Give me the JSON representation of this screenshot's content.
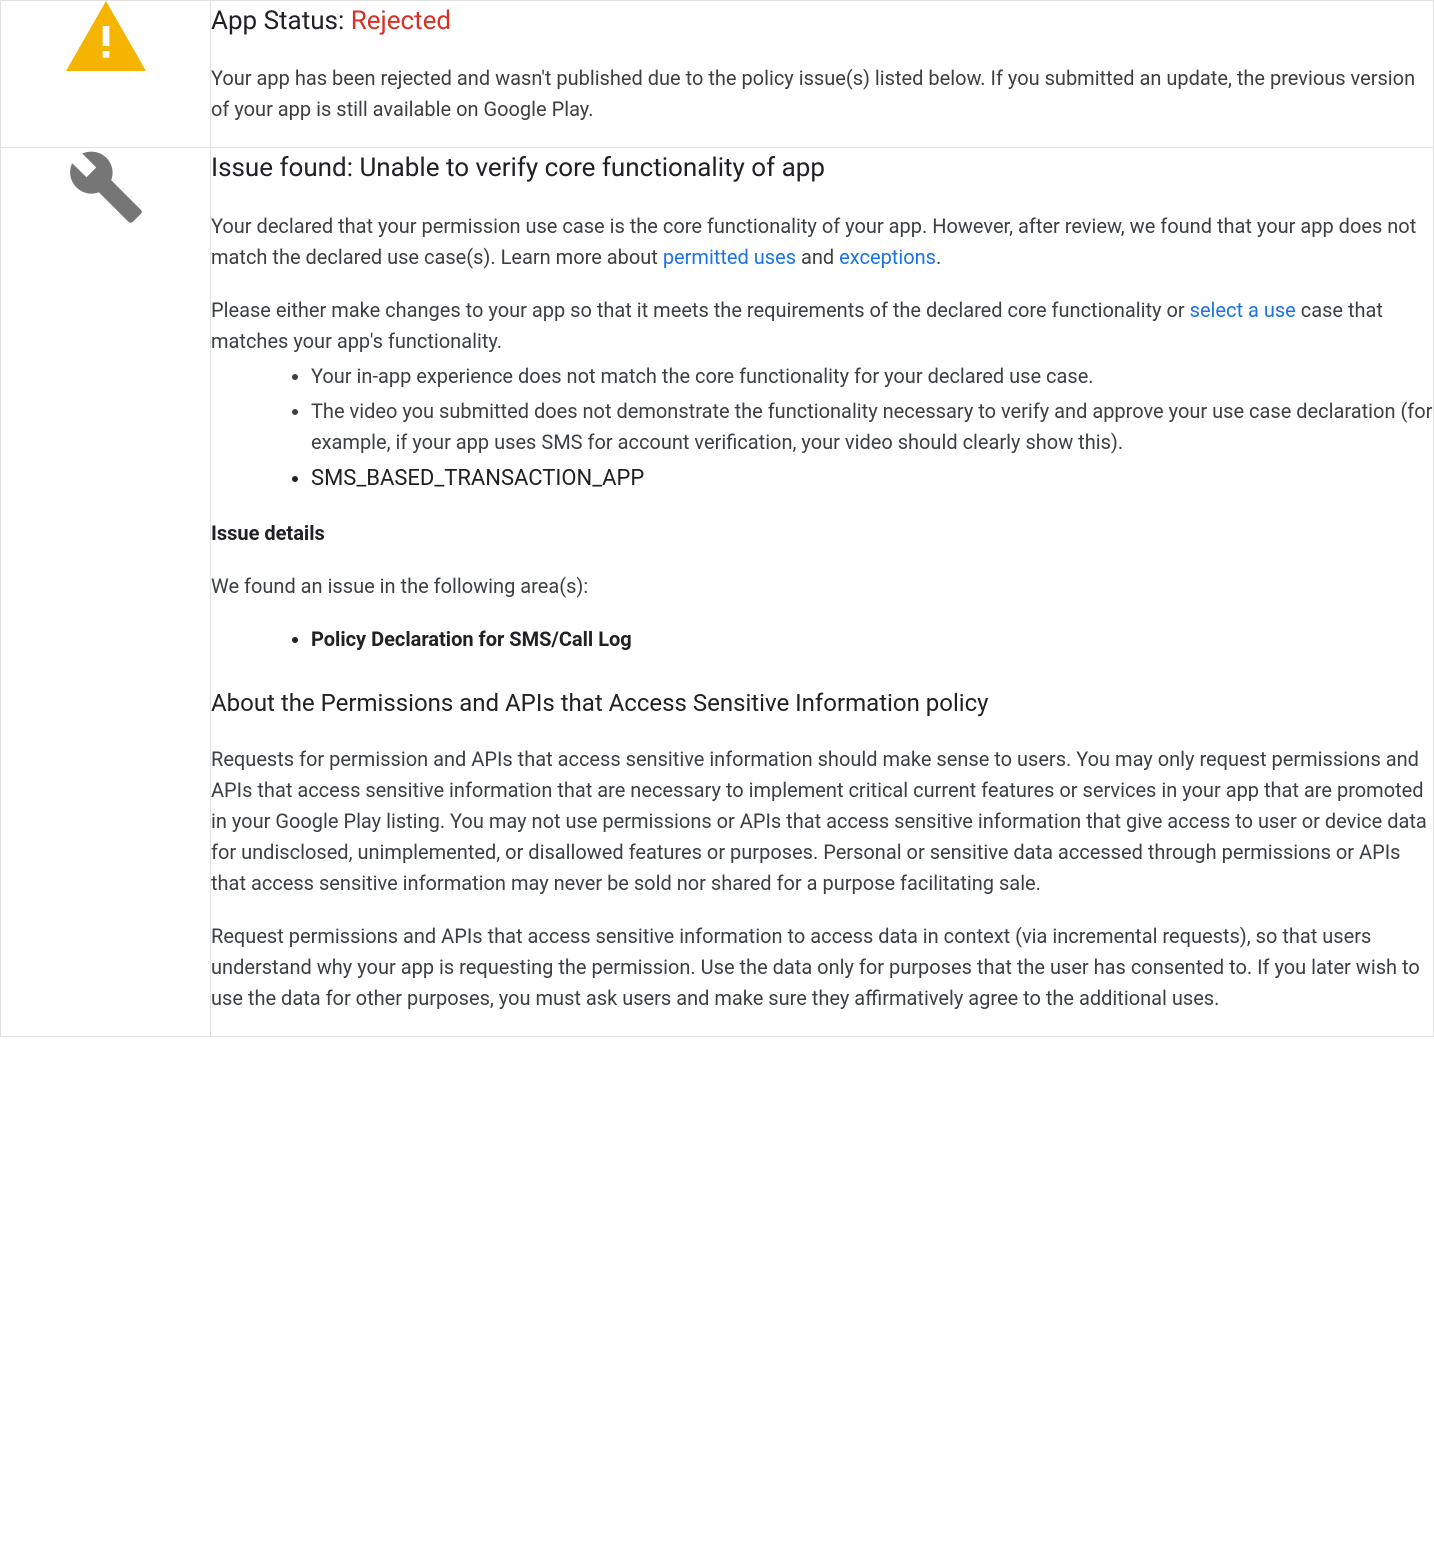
{
  "status": {
    "label_prefix": "App Status: ",
    "status_value": "Rejected",
    "description": "Your app has been rejected and wasn't published due to the policy issue(s) listed below. If you submitted an update, the previous version of your app is still available on Google Play."
  },
  "issue": {
    "heading": "Issue found: Unable to verify core functionality of app",
    "para1_a": "Your declared that your permission use case is the core functionality of your app. However, after review, we found that your app does not match the declared use case(s). Learn more about ",
    "link_permitted_uses": "permitted uses",
    "para1_and": " and ",
    "link_exceptions": "exceptions",
    "para1_end": ".",
    "para2_a": "Please either make changes to your app so that it meets the requirements of the declared core functionality or ",
    "link_select_use": "select a use",
    "para2_b": " case that matches your app's functionality.",
    "bullets": [
      "Your in-app experience does not match the core functionality for your declared use case.",
      "The video you submitted does not demonstrate the functionality necessary to verify and approve your use case declaration (for example, if your app uses SMS for account verification, your video should clearly show this).",
      "SMS_BASED_TRANSACTION_APP"
    ],
    "details_label": "Issue details",
    "areas_intro": "We found an issue in the following area(s):",
    "areas": [
      "Policy Declaration for SMS/Call Log"
    ],
    "policy_heading": "About the Permissions and APIs that Access Sensitive Information policy",
    "policy_para1": "Requests for permission and APIs that access sensitive information should make sense to users. You may only request permissions and APIs that access sensitive information that are necessary to implement critical current features or services in your app that are promoted in your Google Play listing. You may not use permissions or APIs that access sensitive information that give access to user or device data for undisclosed, unimplemented, or disallowed features or purposes. Personal or sensitive data accessed through permissions or APIs that access sensitive information may never be sold nor shared for a purpose facilitating sale.",
    "policy_para2": "Request permissions and APIs that access sensitive information to access data in context (via incremental requests), so that users understand why your app is requesting the permission. Use the data only for purposes that the user has consented to. If you later wish to use the data for other purposes, you must ask users and make sure they affirmatively agree to the additional uses."
  }
}
